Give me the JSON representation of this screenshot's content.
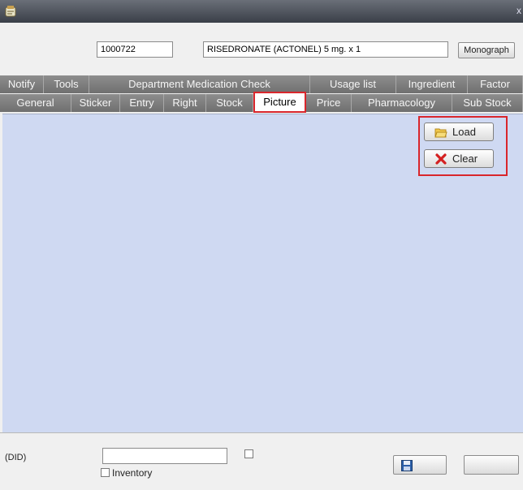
{
  "window": {
    "title": "",
    "close": "x"
  },
  "header": {
    "code_label": "",
    "code_value": "1000722",
    "name_label": "",
    "name_value": "RISEDRONATE (ACTONEL) 5 mg. x 1 ",
    "monograph_label": "Monograph"
  },
  "tabs_row1": [
    "Notify",
    "Tools",
    "Department Medication Check",
    "Usage list",
    "Ingredient",
    "Factor"
  ],
  "tabs_row2": [
    "General",
    "Sticker",
    "Entry",
    "Right",
    "Stock",
    "Picture",
    "Price",
    "Pharmacology",
    "Sub Stock"
  ],
  "active_tab": "Picture",
  "picture": {
    "load_label": "Load",
    "clear_label": "Clear"
  },
  "bottom": {
    "did_label": " (DID)",
    "did_value": "",
    "cancel_use_label": "",
    "inventory_label": " Inventory",
    "save_label": "",
    "cancel_label": ""
  },
  "colors": {
    "highlight": "#d9262c",
    "content_bg": "#cfd9f2",
    "tab_bg": "#7d7d7d"
  },
  "icons": {
    "window": "app-icon",
    "load": "folder-open-icon",
    "clear": "red-x-icon",
    "save": "floppy-disk-icon"
  }
}
